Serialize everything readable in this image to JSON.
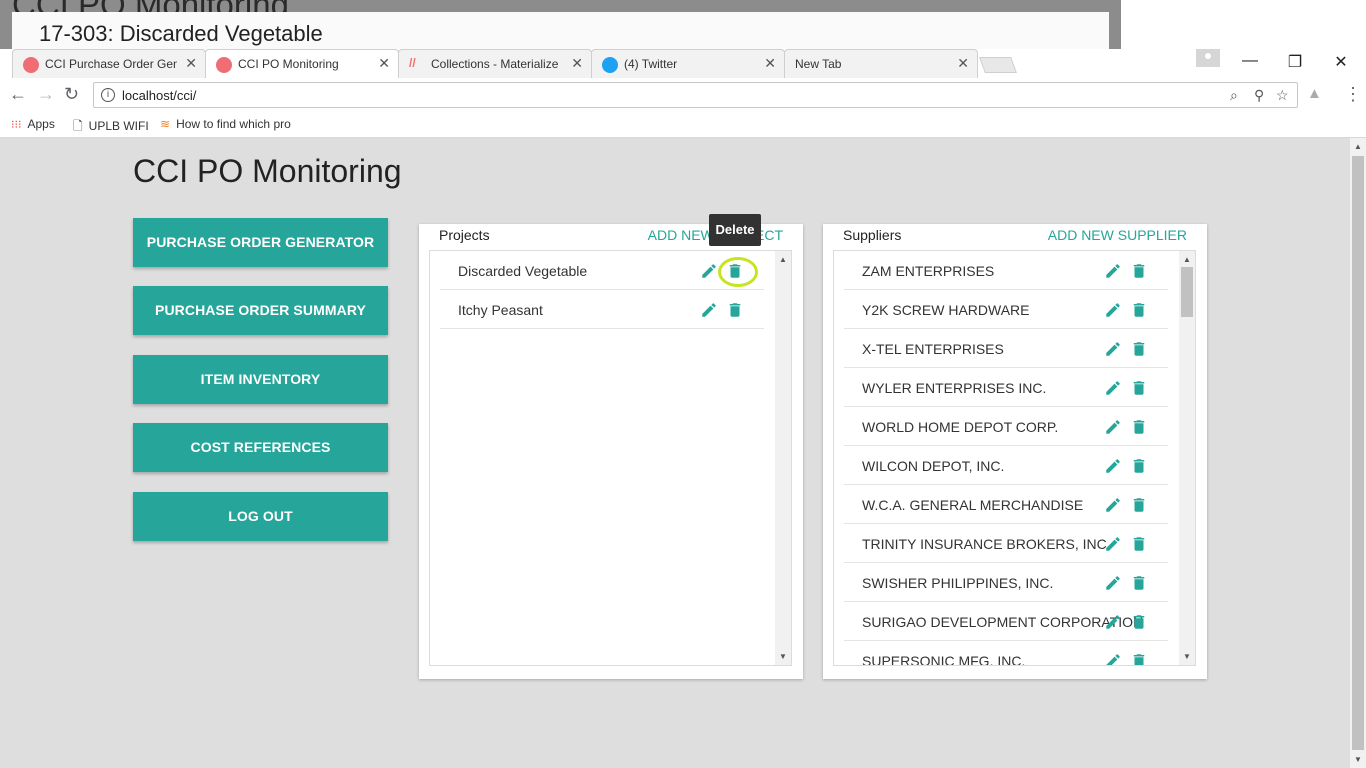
{
  "background_window": {
    "text": "CCI PO Monitoring"
  },
  "dialog": {
    "title": "17-303: Discarded Vegetable"
  },
  "tabs": [
    {
      "label": "CCI Purchase Order Gene",
      "favicon": "materialize-icon"
    },
    {
      "label": "CCI PO Monitoring",
      "favicon": "materialize-icon"
    },
    {
      "label": "Collections - Materialize",
      "favicon": "materialize-logo-icon"
    },
    {
      "label": "(4) Twitter",
      "favicon": "twitter-icon"
    },
    {
      "label": "New Tab",
      "favicon": ""
    }
  ],
  "address_bar": {
    "url": "localhost/cci/"
  },
  "bookmarks": [
    {
      "label": "Apps"
    },
    {
      "label": "UPLB WIFI"
    },
    {
      "label": "How to find which pro"
    }
  ],
  "page": {
    "title": "CCI PO Monitoring",
    "menu": [
      {
        "label": "PURCHASE ORDER GENERATOR"
      },
      {
        "label": "PURCHASE ORDER SUMMARY"
      },
      {
        "label": "ITEM INVENTORY"
      },
      {
        "label": "COST REFERENCES"
      },
      {
        "label": "LOG OUT"
      }
    ],
    "projects": {
      "title": "Projects",
      "add_label": "ADD NEW PROJECT",
      "items": [
        {
          "name": "Discarded Vegetable"
        },
        {
          "name": "Itchy Peasant"
        }
      ]
    },
    "suppliers": {
      "title": "Suppliers",
      "add_label": "ADD NEW SUPPLIER",
      "items": [
        {
          "name": "ZAM ENTERPRISES"
        },
        {
          "name": "Y2K SCREW HARDWARE"
        },
        {
          "name": "X-TEL ENTERPRISES"
        },
        {
          "name": "WYLER ENTERPRISES INC."
        },
        {
          "name": "WORLD HOME DEPOT CORP."
        },
        {
          "name": "WILCON DEPOT, INC."
        },
        {
          "name": "W.C.A. GENERAL MERCHANDISE"
        },
        {
          "name": "TRINITY INSURANCE BROKERS, INC"
        },
        {
          "name": "SWISHER PHILIPPINES, INC."
        },
        {
          "name": "SURIGAO DEVELOPMENT CORPORATION"
        },
        {
          "name": "SUPERSONIC MFG. INC."
        }
      ]
    },
    "tooltip": "Delete"
  },
  "colors": {
    "accent": "#26a69a",
    "highlight": "#c6e51e",
    "tooltip_bg": "#323232"
  }
}
